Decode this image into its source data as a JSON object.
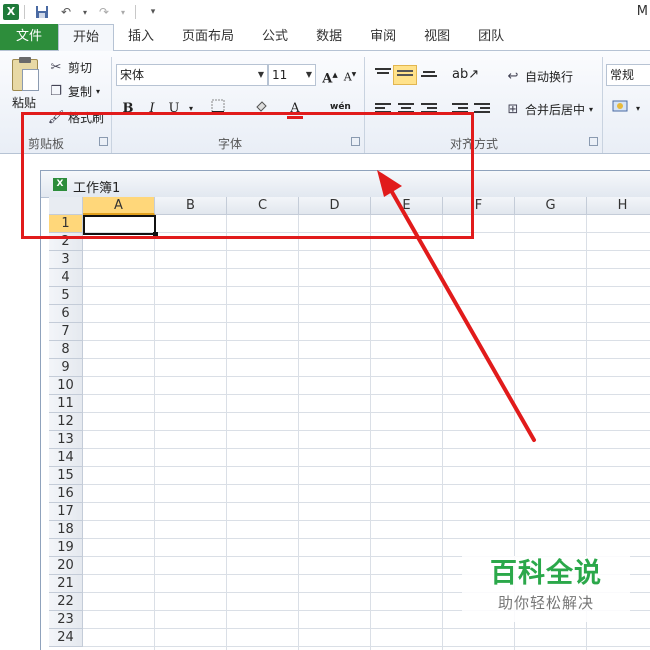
{
  "app": {
    "title": "M",
    "logo": "X"
  },
  "tabs": [
    {
      "label": "文件"
    },
    {
      "label": "开始"
    },
    {
      "label": "插入"
    },
    {
      "label": "页面布局"
    },
    {
      "label": "公式"
    },
    {
      "label": "数据"
    },
    {
      "label": "审阅"
    },
    {
      "label": "视图"
    },
    {
      "label": "团队"
    }
  ],
  "clipboard": {
    "paste": "粘贴",
    "cut": "剪切",
    "copy": "复制",
    "format_painter": "格式刷",
    "group": "剪贴板"
  },
  "font": {
    "name": "宋体",
    "size": "11",
    "group": "字体",
    "bold": "B",
    "italic": "I",
    "underline": "U",
    "grow": "A",
    "shrink": "A",
    "color": "A",
    "phonetic": "wén"
  },
  "alignment": {
    "wrap": "自动换行",
    "merge": "合并后居中",
    "group": "对齐方式"
  },
  "number": {
    "format": "常规"
  },
  "workbook": {
    "name": "工作簿1",
    "icon": "X"
  },
  "columns": [
    "A",
    "B",
    "C",
    "D",
    "E",
    "F",
    "G",
    "H"
  ],
  "rows": [
    "1",
    "2",
    "3",
    "4",
    "5",
    "6",
    "7",
    "8",
    "9",
    "10",
    "11",
    "12",
    "13",
    "14",
    "15",
    "16",
    "17",
    "18",
    "19",
    "20",
    "21",
    "22",
    "23",
    "24"
  ],
  "selected_cell": "A1",
  "colors": {
    "file_tab": "#2d8d3b",
    "annotation": "#e11b1b",
    "selection": "#ffd77a"
  },
  "watermark": {
    "title": "百科全说",
    "subtitle": "助你轻松解决"
  }
}
